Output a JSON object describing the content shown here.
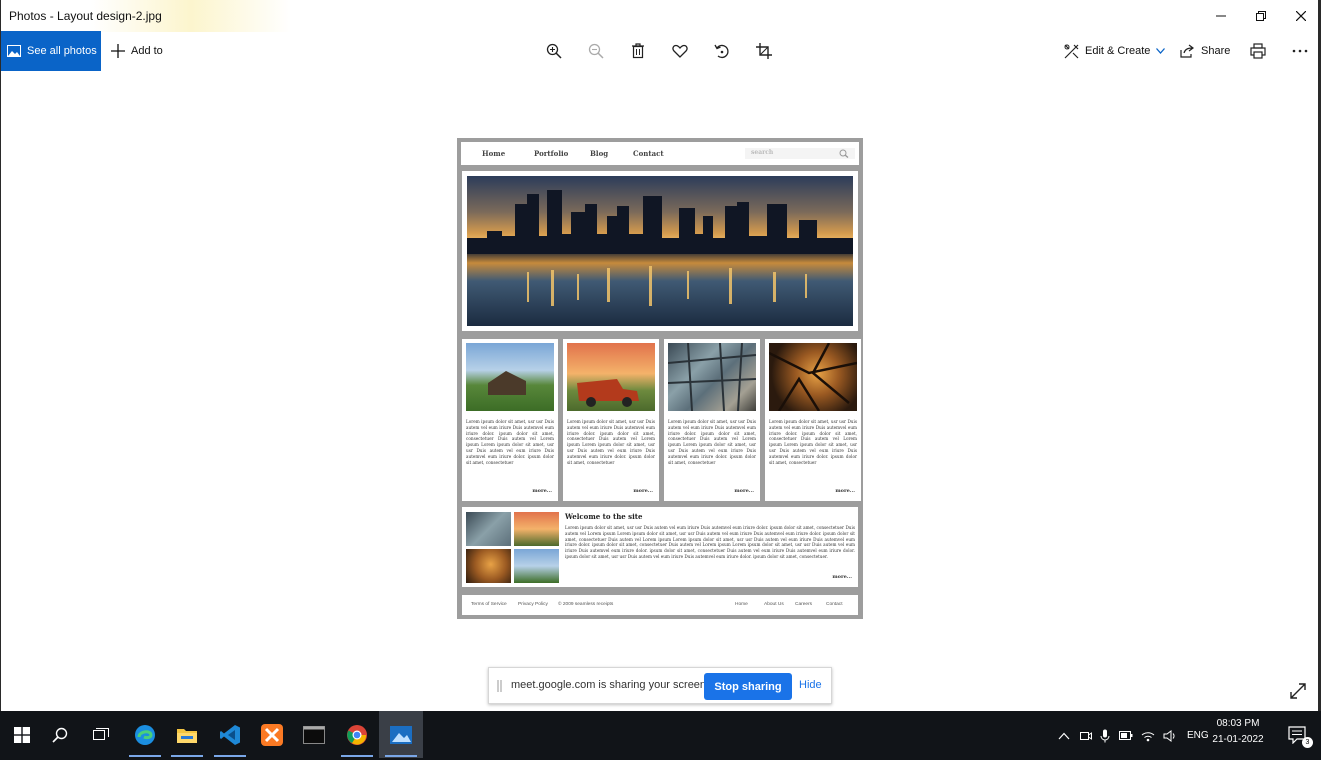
{
  "window": {
    "title": "Photos - Layout design-2.jpg",
    "minimize_icon": "minimize-icon",
    "restore_icon": "restore-icon",
    "close_icon": "close-icon"
  },
  "toolbar": {
    "see_all_label": "See all photos",
    "add_to_label": "Add to",
    "edit_create_label": "Edit & Create",
    "share_label": "Share",
    "icons": [
      "zoom-in-icon",
      "zoom-out-icon",
      "delete-icon",
      "heart-icon",
      "rotate-icon",
      "crop-icon",
      "print-icon",
      "more-icon"
    ]
  },
  "photo": {
    "nav": [
      "Home",
      "Portfolio",
      "Blog",
      "Contact"
    ],
    "search_placeholder": "search",
    "cards": [
      {
        "text": "Lorem ipsum dolor sit amet, usr usr Duis autem vel eum iriure Duis autemvel eum iriure dolor. ipsum dolor sit amet, consectetuer Duis autem vel Lorem ipsum Lorem ipsum dolor sit amet, usr usr Duis autem vel eum iriure Duis autemvel eum iriure dolor. ipsum dolor sit amet, consectetuer",
        "more": "more..."
      },
      {
        "text": "Lorem ipsum dolor sit amet, usr usr Duis autem vel eum iriure Duis autemvel eum iriure dolor. ipsum dolor sit amet, consectetuer Duis autem vel Lorem ipsum Lorem ipsum dolor sit amet, usr usr Duis autem vel eum iriure Duis autemvel eum iriure dolor. ipsum dolor sit amet, consectetuer",
        "more": "more..."
      },
      {
        "text": "Lorem ipsum dolor sit amet, usr usr Duis autem vel eum iriure Duis autemvel eum iriure dolor. ipsum dolor sit amet, consectetuer Duis autem vel Lorem ipsum Lorem ipsum dolor sit amet, usr usr Duis autem vel eum iriure Duis autemvel eum iriure dolor. ipsum dolor sit amet, consectetuer",
        "more": "more..."
      },
      {
        "text": "Lorem ipsum dolor sit amet, usr usr Duis autem vel eum iriure Duis autemvel eum iriure dolor. ipsum dolor sit amet, consectetuer Duis autem vel Lorem ipsum Lorem ipsum dolor sit amet, usr usr Duis autem vel eum iriure Duis autemvel eum iriure dolor. ipsum dolor sit amet, consectetuer",
        "more": "more..."
      }
    ],
    "welcome_title": "Welcome to the site",
    "welcome_text": "Lorem ipsum dolor sit amet, usr usr Duis autem vel eum iriure Duis autemvel eum iriure dolor. ipsum dolor sit amet, consectetuer Duis autem vel Lorem ipsum Lorem ipsum dolor sit amet, usr usr Duis autem vel eum iriure Duis autemvel eum iriure dolor. ipsum dolor sit amet, consectetuer Duis autem vel Lorem ipsum Lorem ipsum dolor sit amet, usr usr Duis autem vel eum iriure Duis autemvel eum iriure dolor. ipsum dolor sit amet, consectetuer Duis autem vel Lorem ipsum Lorem ipsum dolor sit amet, usr usr Duis autem vel eum iriure Duis autemvel eum iriure dolor. ipsum dolor sit amet, consectetuer Duis autem vel eum iriure Duis autemvel eum iriure dolor. ipsum dolor sit amet, usr usr Duis autem vel eum iriure Duis autemvel eum iriure dolor. ipsum dolor sit amet, consectetuer.",
    "welcome_more": "more...",
    "footer_left": [
      "Terms of Service",
      "Privacy Policy",
      "© 2009 seamless receipts"
    ],
    "footer_right": [
      "Home",
      "About Us",
      "Careers",
      "Contact"
    ]
  },
  "sharebar": {
    "message": "meet.google.com is sharing your screen.",
    "stop_label": "Stop sharing",
    "hide_label": "Hide"
  },
  "taskbar": {
    "apps": [
      "start-icon",
      "search-icon",
      "task-view-icon",
      "edge-icon",
      "file-explorer-icon",
      "vscode-icon",
      "xampp-icon",
      "terminal-icon",
      "chrome-icon",
      "photos-icon"
    ],
    "language": "ENG",
    "time": "08:03 PM",
    "date": "21-01-2022",
    "notification_count": "3"
  },
  "colors": {
    "accent": "#0a64c8",
    "meet_blue": "#1a73e8",
    "taskbar": "#111418"
  }
}
